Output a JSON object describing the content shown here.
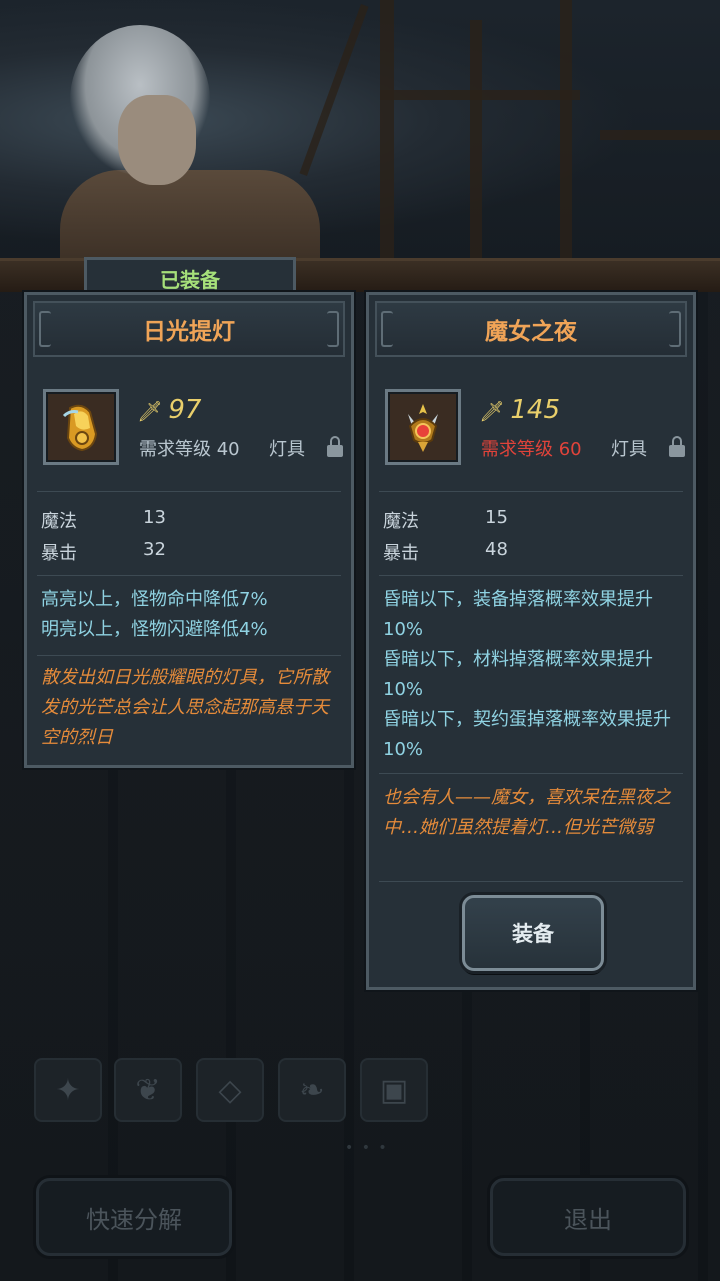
{
  "equipped_tab": {
    "label": "已装备"
  },
  "left_item": {
    "name": "日光提灯",
    "power": "97",
    "level_req": "需求等级 40",
    "type": "灯具",
    "stats": [
      {
        "name": "魔法",
        "value": "13"
      },
      {
        "name": "暴击",
        "value": "32"
      }
    ],
    "effects": [
      "高亮以上，怪物命中降低7%",
      "明亮以上，怪物闪避降低4%"
    ],
    "flavor": "散发出如日光般耀眼的灯具，它所散发的光芒总会让人思念起那高悬于天空的烈日"
  },
  "right_item": {
    "name": "魔女之夜",
    "power": "145",
    "level_req": "需求等级 60",
    "level_req_color": "#e0433a",
    "type": "灯具",
    "stats": [
      {
        "name": "魔法",
        "value": "15"
      },
      {
        "name": "暴击",
        "value": "48"
      }
    ],
    "effects": [
      "昏暗以下，装备掉落概率效果提升10%",
      "昏暗以下，材料掉落概率效果提升10%",
      "昏暗以下，契约蛋掉落概率效果提升10%"
    ],
    "flavor": "也会有人——魔女，喜欢呆在黑夜之中…她们虽然提着灯…但光芒微弱",
    "equip_button": "装备"
  },
  "category_icons": [
    "weapon-icon",
    "paw-icon",
    "gem-icon",
    "leaf-icon",
    "chest-icon"
  ],
  "buttons": {
    "quick_disassemble": "快速分解",
    "exit": "退出"
  },
  "colors": {
    "item_name": "#f0a457",
    "equipped": "#a6e07a",
    "effect": "#8fd2e2",
    "flavor": "#e58b3a",
    "power": "#e9cf6b"
  }
}
